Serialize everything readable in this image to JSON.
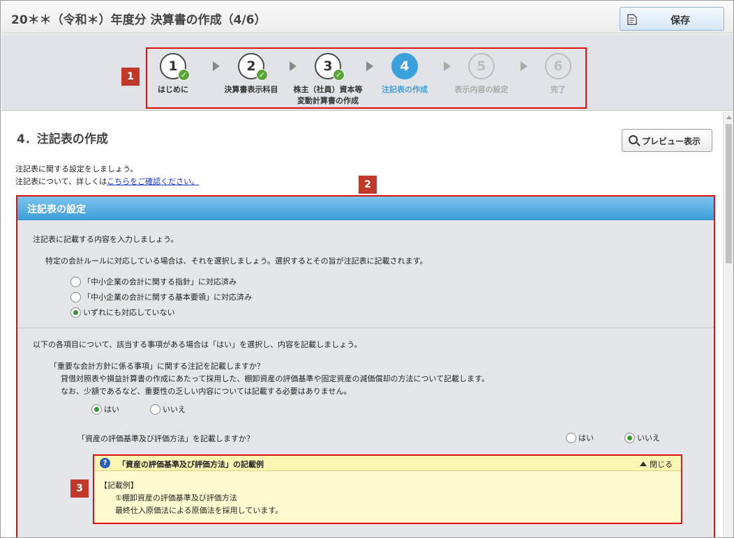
{
  "window": {
    "title": "20＊＊（令和＊）年度分 決算書の作成（4/6）"
  },
  "toolbar": {
    "save_label": "保存"
  },
  "markers": [
    "1",
    "2",
    "3"
  ],
  "steps": [
    {
      "num": "1",
      "label": "はじめに",
      "label2": "",
      "state": "done"
    },
    {
      "num": "2",
      "label": "決算書表示科目",
      "label2": "",
      "state": "done"
    },
    {
      "num": "3",
      "label": "株主（社員）資本等",
      "label2": "変動計算書の作成",
      "state": "done"
    },
    {
      "num": "4",
      "label": "注記表の作成",
      "label2": "",
      "state": "active"
    },
    {
      "num": "5",
      "label": "表示内容の設定",
      "label2": "",
      "state": "disabled"
    },
    {
      "num": "6",
      "label": "完了",
      "label2": "",
      "state": "disabled"
    }
  ],
  "main": {
    "heading": "4．注記表の作成",
    "preview_label": "プレビュー表示",
    "intro1": "注記表に関する設定をしましょう。",
    "intro2_prefix": "注記表について、詳しくは",
    "intro2_link": "こちらをご確認ください。"
  },
  "panel": {
    "header": "注記表の設定",
    "instruction": "注記表に記載する内容を入力しましょう。",
    "rule_text": "特定の会計ルールに対応している場合は、それを選択しましょう。選択するとその旨が注記表に記載されます。",
    "rule_options": [
      {
        "label": "「中小企業の会計に関する指針」に対応済み",
        "selected": false
      },
      {
        "label": "「中小企業の会計に関する基本要領」に対応済み",
        "selected": false
      },
      {
        "label": "いずれにも対応していない",
        "selected": true
      }
    ],
    "items_intro": "以下の各項目について、該当する事項がある場合は「はい」を選択し、内容を記載しましょう。",
    "q1": {
      "question": "「重要な会計方針に係る事項」に関する注記を記載しますか？",
      "desc1": "貸借対照表や損益計算書の作成にあたって採用した、棚卸資産の評価基準や固定資産の減価償却の方法について記載します。",
      "desc2": "なお、少額であるなど、重要性の乏しい内容については記載する必要はありません。",
      "yes": "はい",
      "no": "いいえ",
      "value": "yes"
    },
    "q2": {
      "question": "「資産の評価基準及び評価方法」を記載しますか？",
      "yes": "はい",
      "no": "いいえ",
      "value": "no"
    },
    "example": {
      "title": "「資産の評価基準及び評価方法」の記載例",
      "close_label": "閉じる",
      "line1": "【記載例】",
      "line2": "①棚卸資産の評価基準及び評価方法",
      "line3": "最終仕入原価法による原価法を採用しています。"
    }
  }
}
